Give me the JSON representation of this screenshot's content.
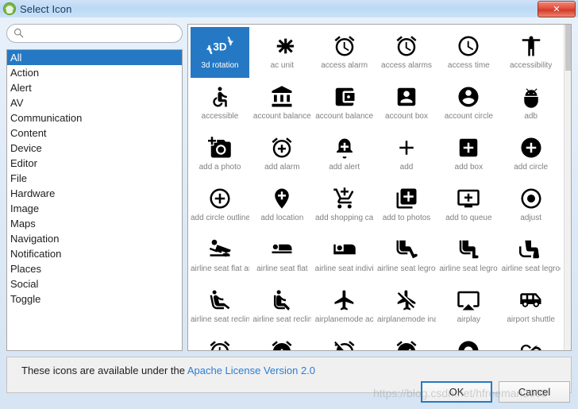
{
  "window": {
    "title": "Select Icon",
    "app_icon": "android-robot-icon",
    "close_label": "✕"
  },
  "search": {
    "value": "",
    "placeholder": "",
    "icon": "search-icon"
  },
  "categories": {
    "selected": "All",
    "items": [
      "All",
      "Action",
      "Alert",
      "AV",
      "Communication",
      "Content",
      "Device",
      "Editor",
      "File",
      "Hardware",
      "Image",
      "Maps",
      "Navigation",
      "Notification",
      "Places",
      "Social",
      "Toggle"
    ]
  },
  "icon_grid": {
    "selected_index": 0,
    "icons": [
      {
        "label": "3d rotation",
        "icon": "3d-rotation-icon"
      },
      {
        "label": "ac unit",
        "icon": "ac-unit-icon"
      },
      {
        "label": "access alarm",
        "icon": "access-alarm-icon"
      },
      {
        "label": "access alarms",
        "icon": "access-alarms-icon"
      },
      {
        "label": "access time",
        "icon": "access-time-icon"
      },
      {
        "label": "accessibility",
        "icon": "accessibility-icon"
      },
      {
        "label": "accessible",
        "icon": "accessible-icon"
      },
      {
        "label": "account balance",
        "icon": "account-balance-icon"
      },
      {
        "label": "account balance",
        "icon": "account-balance-wallet-icon"
      },
      {
        "label": "account box",
        "icon": "account-box-icon"
      },
      {
        "label": "account circle",
        "icon": "account-circle-icon"
      },
      {
        "label": "adb",
        "icon": "adb-icon"
      },
      {
        "label": "add a photo",
        "icon": "add-a-photo-icon"
      },
      {
        "label": "add alarm",
        "icon": "add-alarm-icon"
      },
      {
        "label": "add alert",
        "icon": "add-alert-icon"
      },
      {
        "label": "add",
        "icon": "add-icon"
      },
      {
        "label": "add box",
        "icon": "add-box-icon"
      },
      {
        "label": "add circle",
        "icon": "add-circle-icon"
      },
      {
        "label": "add circle outline",
        "icon": "add-circle-outline-icon"
      },
      {
        "label": "add location",
        "icon": "add-location-icon"
      },
      {
        "label": "add shopping ca",
        "icon": "add-shopping-cart-icon"
      },
      {
        "label": "add to photos",
        "icon": "add-to-photos-icon"
      },
      {
        "label": "add to queue",
        "icon": "add-to-queue-icon"
      },
      {
        "label": "adjust",
        "icon": "adjust-icon"
      },
      {
        "label": "airline seat flat an",
        "icon": "airline-seat-flat-angled-icon"
      },
      {
        "label": "airline seat flat",
        "icon": "airline-seat-flat-icon"
      },
      {
        "label": "airline seat individ",
        "icon": "airline-seat-individual-suite-icon"
      },
      {
        "label": "airline seat legroo",
        "icon": "airline-seat-legroom-extra-icon"
      },
      {
        "label": "airline seat legroo",
        "icon": "airline-seat-legroom-normal-icon"
      },
      {
        "label": "airline seat legroo",
        "icon": "airline-seat-legroom-reduced-icon"
      },
      {
        "label": "airline seat reclin",
        "icon": "airline-seat-recline-extra-icon"
      },
      {
        "label": "airline seat reclin",
        "icon": "airline-seat-recline-normal-icon"
      },
      {
        "label": "airplanemode ac",
        "icon": "airplanemode-active-icon"
      },
      {
        "label": "airplanemode ina",
        "icon": "airplanemode-inactive-icon"
      },
      {
        "label": "airplay",
        "icon": "airplay-icon"
      },
      {
        "label": "airport shuttle",
        "icon": "airport-shuttle-icon"
      },
      {
        "label": "",
        "icon": "alarm-icon"
      },
      {
        "label": "",
        "icon": "alarm-add-icon"
      },
      {
        "label": "",
        "icon": "alarm-off-icon"
      },
      {
        "label": "",
        "icon": "alarm-on-icon"
      },
      {
        "label": "",
        "icon": "album-icon"
      },
      {
        "label": "",
        "icon": "all-inclusive-icon"
      }
    ]
  },
  "license": {
    "text": "These icons are available under the ",
    "link_label": "Apache License Version 2.0"
  },
  "footer": {
    "ok_label": "OK",
    "cancel_label": "Cancel"
  },
  "watermark": {
    "text": "https://blog.csdn.net/hfreeman2008"
  },
  "colors": {
    "accent": "#2579c4",
    "link": "#2d7dd2",
    "caption": "#808080",
    "close_red": "#d33a25"
  }
}
